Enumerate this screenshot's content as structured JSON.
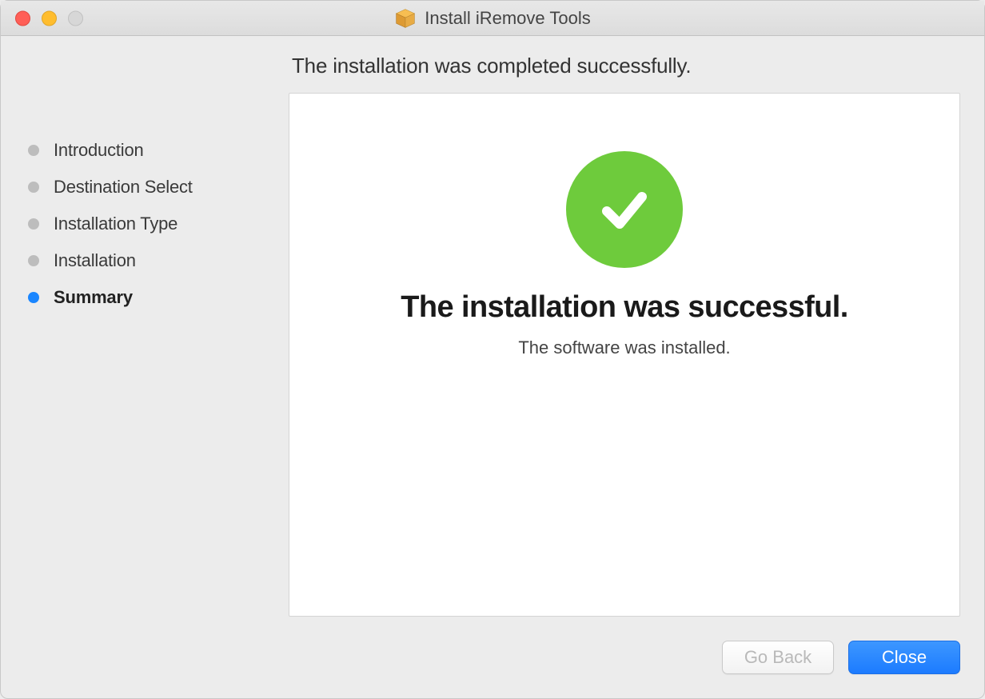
{
  "titlebar": {
    "title": "Install iRemove Tools"
  },
  "sidebar": {
    "steps": [
      {
        "label": "Introduction",
        "active": false
      },
      {
        "label": "Destination Select",
        "active": false
      },
      {
        "label": "Installation Type",
        "active": false
      },
      {
        "label": "Installation",
        "active": false
      },
      {
        "label": "Summary",
        "active": true
      }
    ]
  },
  "main": {
    "heading": "The installation was completed successfully.",
    "panel_title": "The installation was successful.",
    "panel_subtitle": "The software was installed."
  },
  "footer": {
    "go_back_label": "Go Back",
    "close_label": "Close"
  }
}
